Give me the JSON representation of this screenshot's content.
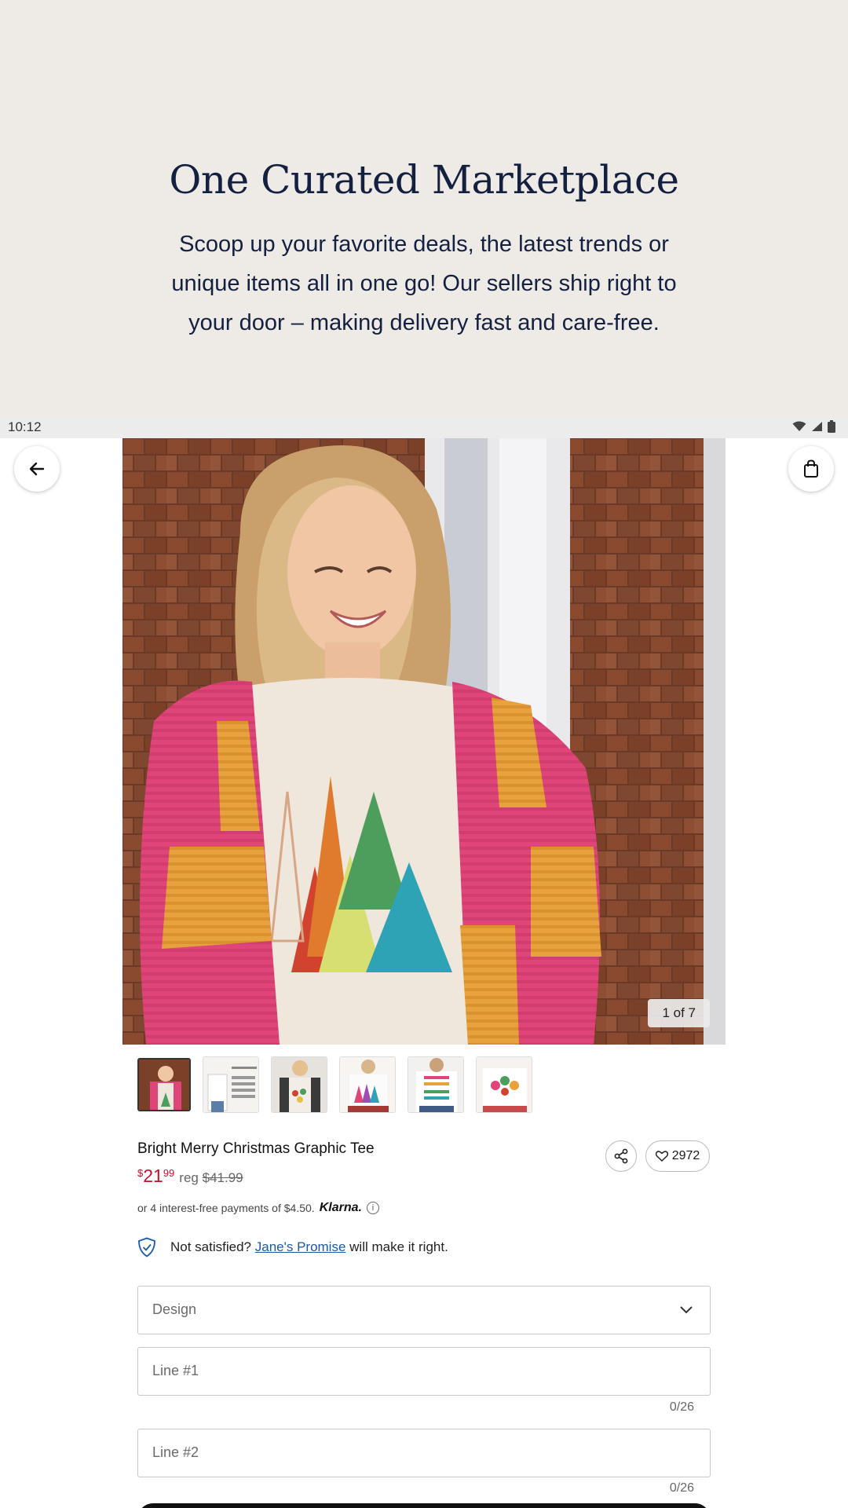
{
  "promo": {
    "title": "One Curated Marketplace",
    "body": "Scoop up your favorite deals, the latest trends or unique items all in one go! Our sellers ship right to your door – making delivery fast and care-free."
  },
  "status_bar": {
    "time": "10:12",
    "icons": [
      "wifi-icon",
      "signal-icon",
      "battery-icon"
    ]
  },
  "navigation": {
    "back_icon": "arrow-left-icon",
    "bag_icon": "shopping-bag-icon"
  },
  "gallery": {
    "counter": "1 of 7",
    "thumbnail_count": 6,
    "active_index": 0
  },
  "product": {
    "title": "Bright Merry Christmas Graphic Tee",
    "price_dollar_sign": "$",
    "price_whole": "21",
    "price_cents": "99",
    "reg_label": "reg",
    "reg_price": "$41.99",
    "favorites_count": "2972",
    "installments_text": "or 4 interest-free payments of $4.50.",
    "klarna_label": "Klarna.",
    "info_glyph": "i"
  },
  "promise": {
    "prefix": "Not satisfied?",
    "link": "Jane's Promise",
    "suffix": "will make it right."
  },
  "form": {
    "design_label": "Design",
    "line1_placeholder": "Line #1",
    "line1_counter": "0/26",
    "line2_placeholder": "Line #2",
    "line2_counter": "0/26"
  },
  "colors": {
    "promo_bg": "#eeeae6",
    "promo_text": "#142040",
    "sale_price": "#c8102e",
    "link": "#1a5aa8"
  }
}
